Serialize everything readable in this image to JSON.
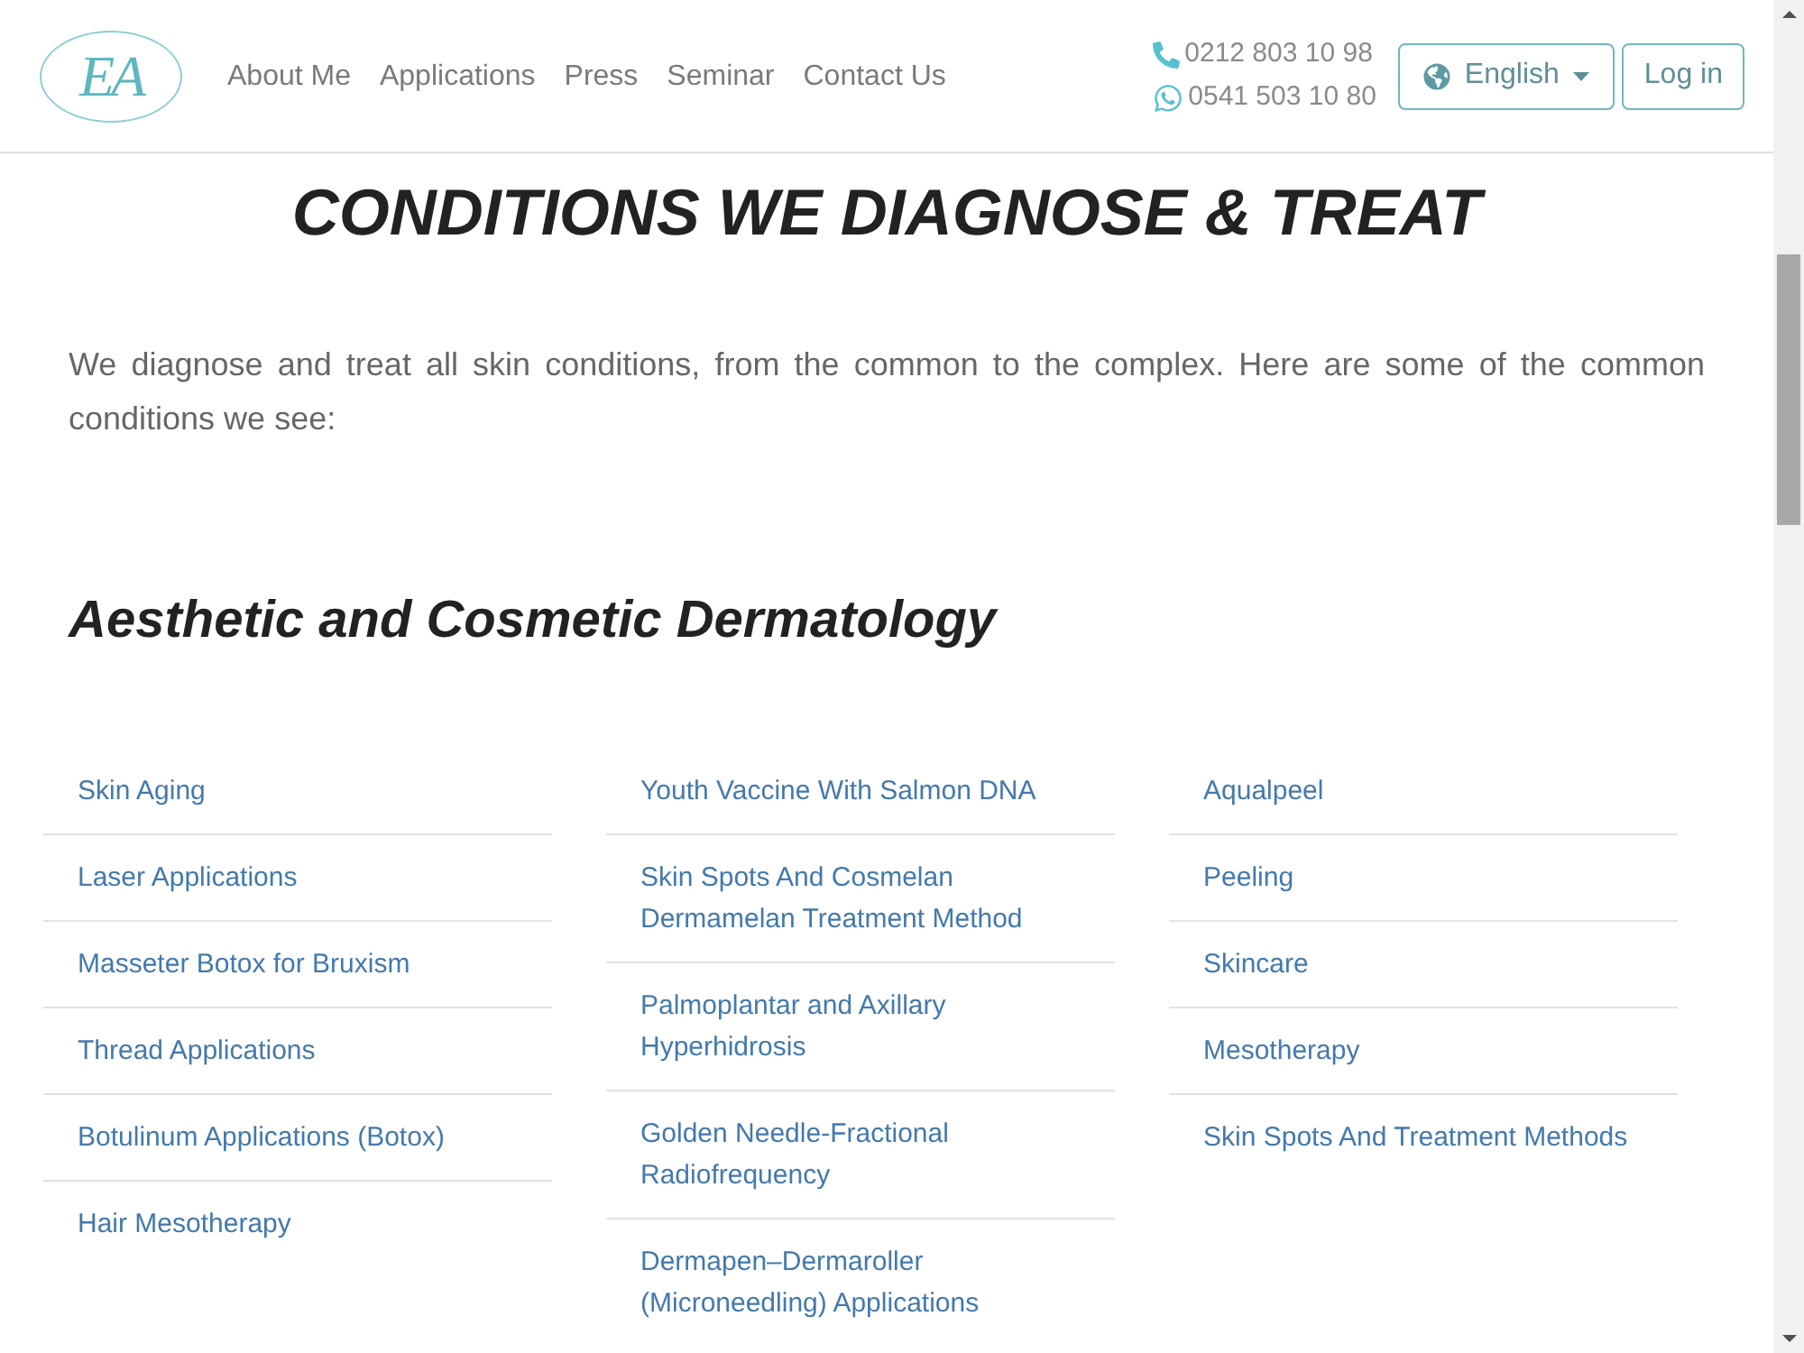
{
  "header": {
    "logo": {
      "monogram": "EA"
    },
    "nav": [
      "About Me",
      "Applications",
      "Press",
      "Seminar",
      "Contact Us"
    ],
    "contacts": [
      {
        "kind": "call",
        "number": "0212 803 10 98"
      },
      {
        "kind": "chat",
        "number": "0541 503 10 80"
      }
    ],
    "language_button": {
      "label": "English"
    },
    "login_button": {
      "label": "Log in"
    }
  },
  "content": {
    "title": "CONDITIONS WE DIAGNOSE & TREAT",
    "intro": "We diagnose and treat all skin conditions, from the common to the complex. Here are some of the common conditions we see:",
    "section_title": "Aesthetic and Cosmetic Dermatology",
    "columns": [
      {
        "items": [
          "Skin Aging",
          "Laser Applications",
          "Masseter Botox for Bruxism",
          "Thread Applications",
          "Botulinum Applications (Botox)",
          "Hair Mesotherapy"
        ]
      },
      {
        "items": [
          "Youth Vaccine With Salmon DNA",
          "Skin Spots And Cosmelan Dermamelan Treatment Method",
          "Palmoplantar and Axillary Hyperhidrosis",
          "Golden Needle-Fractional Radiofrequency",
          "Dermapen–Dermaroller (Microneedling) Applications"
        ]
      },
      {
        "items": [
          "Aqualpeel",
          "Peeling",
          "Skincare",
          "Mesotherapy",
          "Skin Spots And Treatment Methods"
        ]
      }
    ]
  }
}
